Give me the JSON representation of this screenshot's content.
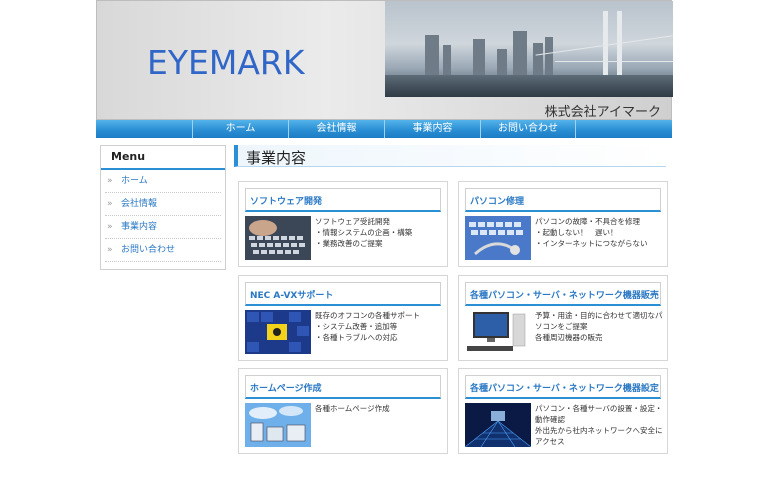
{
  "header": {
    "logo": "EYEMARK",
    "company": "株式会社アイマーク"
  },
  "nav": {
    "items": [
      "ホーム",
      "会社情報",
      "事業内容",
      "お問い合わせ"
    ]
  },
  "sidebar": {
    "title": "Menu",
    "items": [
      "ホーム",
      "会社情報",
      "事業内容",
      "お問い合わせ"
    ]
  },
  "main": {
    "title": "事業内容",
    "cards": [
      {
        "title": "ソフトウェア開発",
        "lines": [
          "ソフトウェア受託開発",
          "・情報システムの企画・構築",
          "・業務改善のご提案"
        ],
        "image": "keyboard-photo"
      },
      {
        "title": "パソコン修理",
        "lines": [
          "パソコンの故障・不具合を修理",
          "・起動しない！　遅い！",
          "・インターネットにつながらない"
        ],
        "image": "stethoscope-keyboard-photo"
      },
      {
        "title": "NEC A-VXサポート",
        "lines": [
          "既存のオフコンの各種サポート",
          "・システム改善・追加等",
          "・各種トラブルへの対応"
        ],
        "image": "yellow-key-photo"
      },
      {
        "title": "各種パソコン・サーバ・ネットワーク機器販売",
        "lines": [
          "予算・用途・目的に合わせて適切なパソコンをご提案",
          "各種周辺機器の販売"
        ],
        "image": "desktop-pc-photo"
      },
      {
        "title": "ホームページ作成",
        "lines": [
          "各種ホームページ作成"
        ],
        "image": "cloud-devices-photo"
      },
      {
        "title": "各種パソコン・サーバ・ネットワーク機器設定",
        "lines": [
          "パソコン・各種サーバの設置・設定・動作確認",
          "外出先から社内ネットワークへ安全にアクセス"
        ],
        "image": "network-room-photo"
      }
    ]
  },
  "colors": {
    "accent": "#2a8fd4",
    "link": "#2a78c4",
    "logo": "#2f66c7"
  }
}
